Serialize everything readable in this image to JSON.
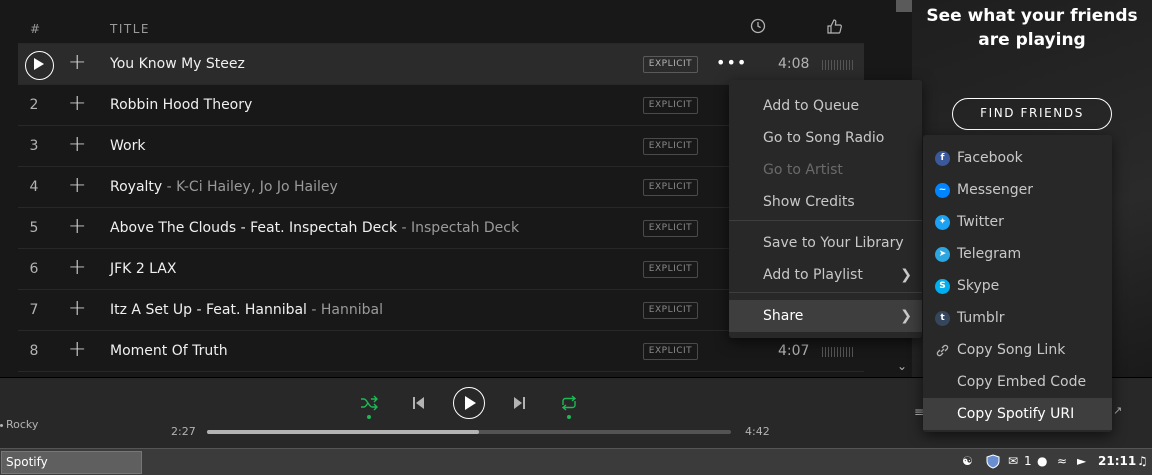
{
  "header": {
    "num": "#",
    "title": "TITLE"
  },
  "tracks": [
    {
      "num": "",
      "title": "You Know My Steez",
      "feat": "",
      "explicit": "EXPLICIT",
      "duration": "4:08",
      "active": true
    },
    {
      "num": "2",
      "title": "Robbin Hood Theory",
      "feat": "",
      "explicit": "EXPLICIT",
      "duration": ""
    },
    {
      "num": "3",
      "title": "Work",
      "feat": "",
      "explicit": "EXPLICIT",
      "duration": ""
    },
    {
      "num": "4",
      "title": "Royalty",
      "feat": "K-Ci Hailey, Jo Jo Hailey",
      "explicit": "EXPLICIT",
      "duration": ""
    },
    {
      "num": "5",
      "title": "Above The Clouds - Feat. Inspectah Deck",
      "feat": "Inspectah Deck",
      "explicit": "EXPLICIT",
      "duration": ""
    },
    {
      "num": "6",
      "title": "JFK 2 LAX",
      "feat": "",
      "explicit": "EXPLICIT",
      "duration": ""
    },
    {
      "num": "7",
      "title": "Itz A Set Up - Feat. Hannibal",
      "feat": "Hannibal",
      "explicit": "EXPLICIT",
      "duration": ""
    },
    {
      "num": "8",
      "title": "Moment Of Truth",
      "feat": "",
      "explicit": "EXPLICIT",
      "duration": "4:07"
    }
  ],
  "friends": {
    "heading_line1": "See what your friends",
    "heading_line2": "are playing",
    "button": "FIND FRIENDS"
  },
  "context_menu": {
    "items": [
      {
        "label": "Add to Queue"
      },
      {
        "label": "Go to Song Radio"
      },
      {
        "label": "Go to Artist",
        "disabled": true
      },
      {
        "label": "Show Credits"
      },
      {
        "label": "Save to Your Library"
      },
      {
        "label": "Add to Playlist",
        "submenu": true
      },
      {
        "label": "Share",
        "submenu": true,
        "highlighted": true
      }
    ]
  },
  "share_menu": {
    "items": [
      {
        "label": "Facebook",
        "icon": "facebook-icon",
        "color": "#3b5998"
      },
      {
        "label": "Messenger",
        "icon": "messenger-icon",
        "color": "#0084ff"
      },
      {
        "label": "Twitter",
        "icon": "twitter-icon",
        "color": "#1da1f2"
      },
      {
        "label": "Telegram",
        "icon": "telegram-icon",
        "color": "#2ca5e0"
      },
      {
        "label": "Skype",
        "icon": "skype-icon",
        "color": "#00aff0"
      },
      {
        "label": "Tumblr",
        "icon": "tumblr-icon",
        "color": "#35465c"
      },
      {
        "label": "Copy Song Link",
        "icon": "link-icon"
      },
      {
        "label": "Copy Embed Code",
        "icon": ""
      },
      {
        "label": "Copy Spotify URI",
        "icon": "",
        "highlighted": true
      }
    ]
  },
  "player": {
    "artist_fragment": "Rocky",
    "elapsed": "2:27",
    "total": "4:42",
    "progress_fraction": 0.52,
    "accent_color": "#1db954"
  },
  "taskbar": {
    "app": "Spotify",
    "badge_count": "1",
    "clock": "21:11"
  }
}
